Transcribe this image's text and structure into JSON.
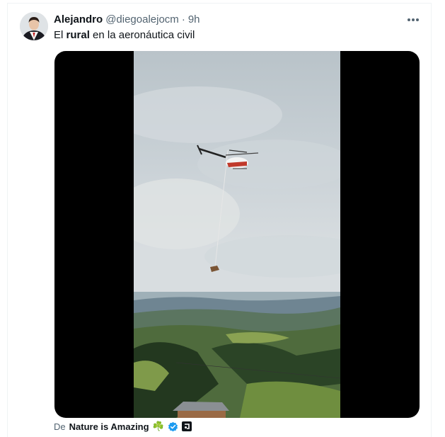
{
  "tweet": {
    "display_name": "Alejandro",
    "handle": "@diegoalejocm",
    "separator": "·",
    "time": "9h",
    "text_before": "El ",
    "text_bold": "rural",
    "text_after": " en la aeronáutica civil",
    "more_icon": "more-horizontal-icon"
  },
  "attribution": {
    "prefix": "De",
    "source": "Nature is Amazing",
    "emoji": "☘️"
  },
  "colors": {
    "text_primary": "#0f1419",
    "text_secondary": "#536471",
    "verified_blue": "#1d9bf0",
    "media_background": "#000000"
  }
}
